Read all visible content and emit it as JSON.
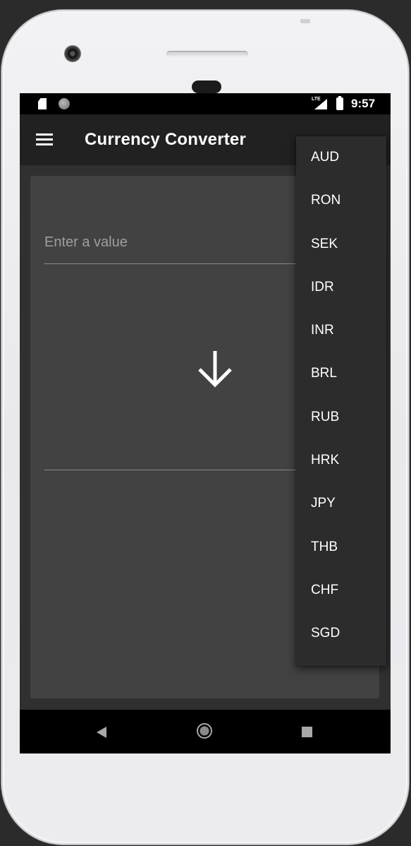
{
  "status_bar": {
    "network_label": "LTE",
    "time": "9:57"
  },
  "app_bar": {
    "title": "Currency Converter"
  },
  "converter": {
    "input": {
      "value": "",
      "placeholder": "Enter a value"
    },
    "result": ""
  },
  "currency_dropdown": {
    "options": [
      "AUD",
      "RON",
      "SEK",
      "IDR",
      "INR",
      "BRL",
      "RUB",
      "HRK",
      "JPY",
      "THB",
      "CHF",
      "SGD"
    ]
  },
  "icons": {
    "menu": "hamburger-menu-icon",
    "convert": "arrow-down-icon",
    "back": "back-triangle-icon",
    "home": "home-circle-icon",
    "recents": "recents-square-icon"
  },
  "colors": {
    "status_bar": "#000000",
    "app_bar": "#212121",
    "background": "#303030",
    "card": "#424242",
    "dropdown": "#2c2c2c",
    "text": "#ffffff",
    "placeholder": "#9e9e9e"
  }
}
